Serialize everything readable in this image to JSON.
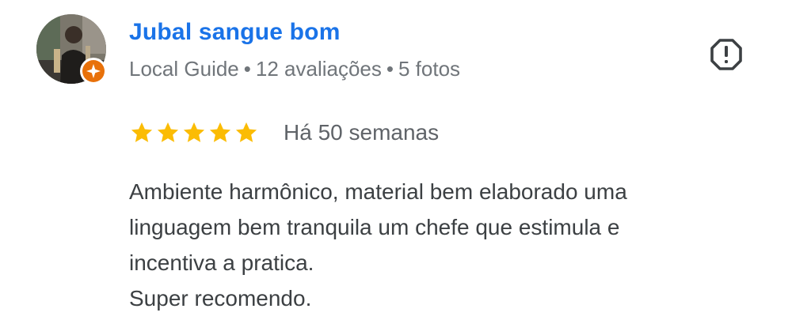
{
  "author": {
    "name": "Jubal sangue bom",
    "badge": "Local Guide",
    "separator": "•",
    "reviews_count": "12 avaliações",
    "photos_count": "5 fotos",
    "avatar_icon": "user-photo-avatar",
    "badge_icon": "local-guide-star-icon"
  },
  "rating": {
    "stars": 5,
    "max_stars": 5,
    "date": "Há 50 semanas",
    "star_color": "#fbbc04"
  },
  "review": {
    "lines": [
      "Ambiente harmônico, material bem elaborado uma",
      "linguagem bem tranquila um chefe que estimula e",
      "incentiva a pratica.",
      "Super recomendo."
    ]
  },
  "actions": {
    "report_icon": "report-flag-icon"
  },
  "colors": {
    "name": "#1a73e8",
    "meta": "#70757a",
    "text": "#3c4043",
    "badge": "#e8710a"
  }
}
